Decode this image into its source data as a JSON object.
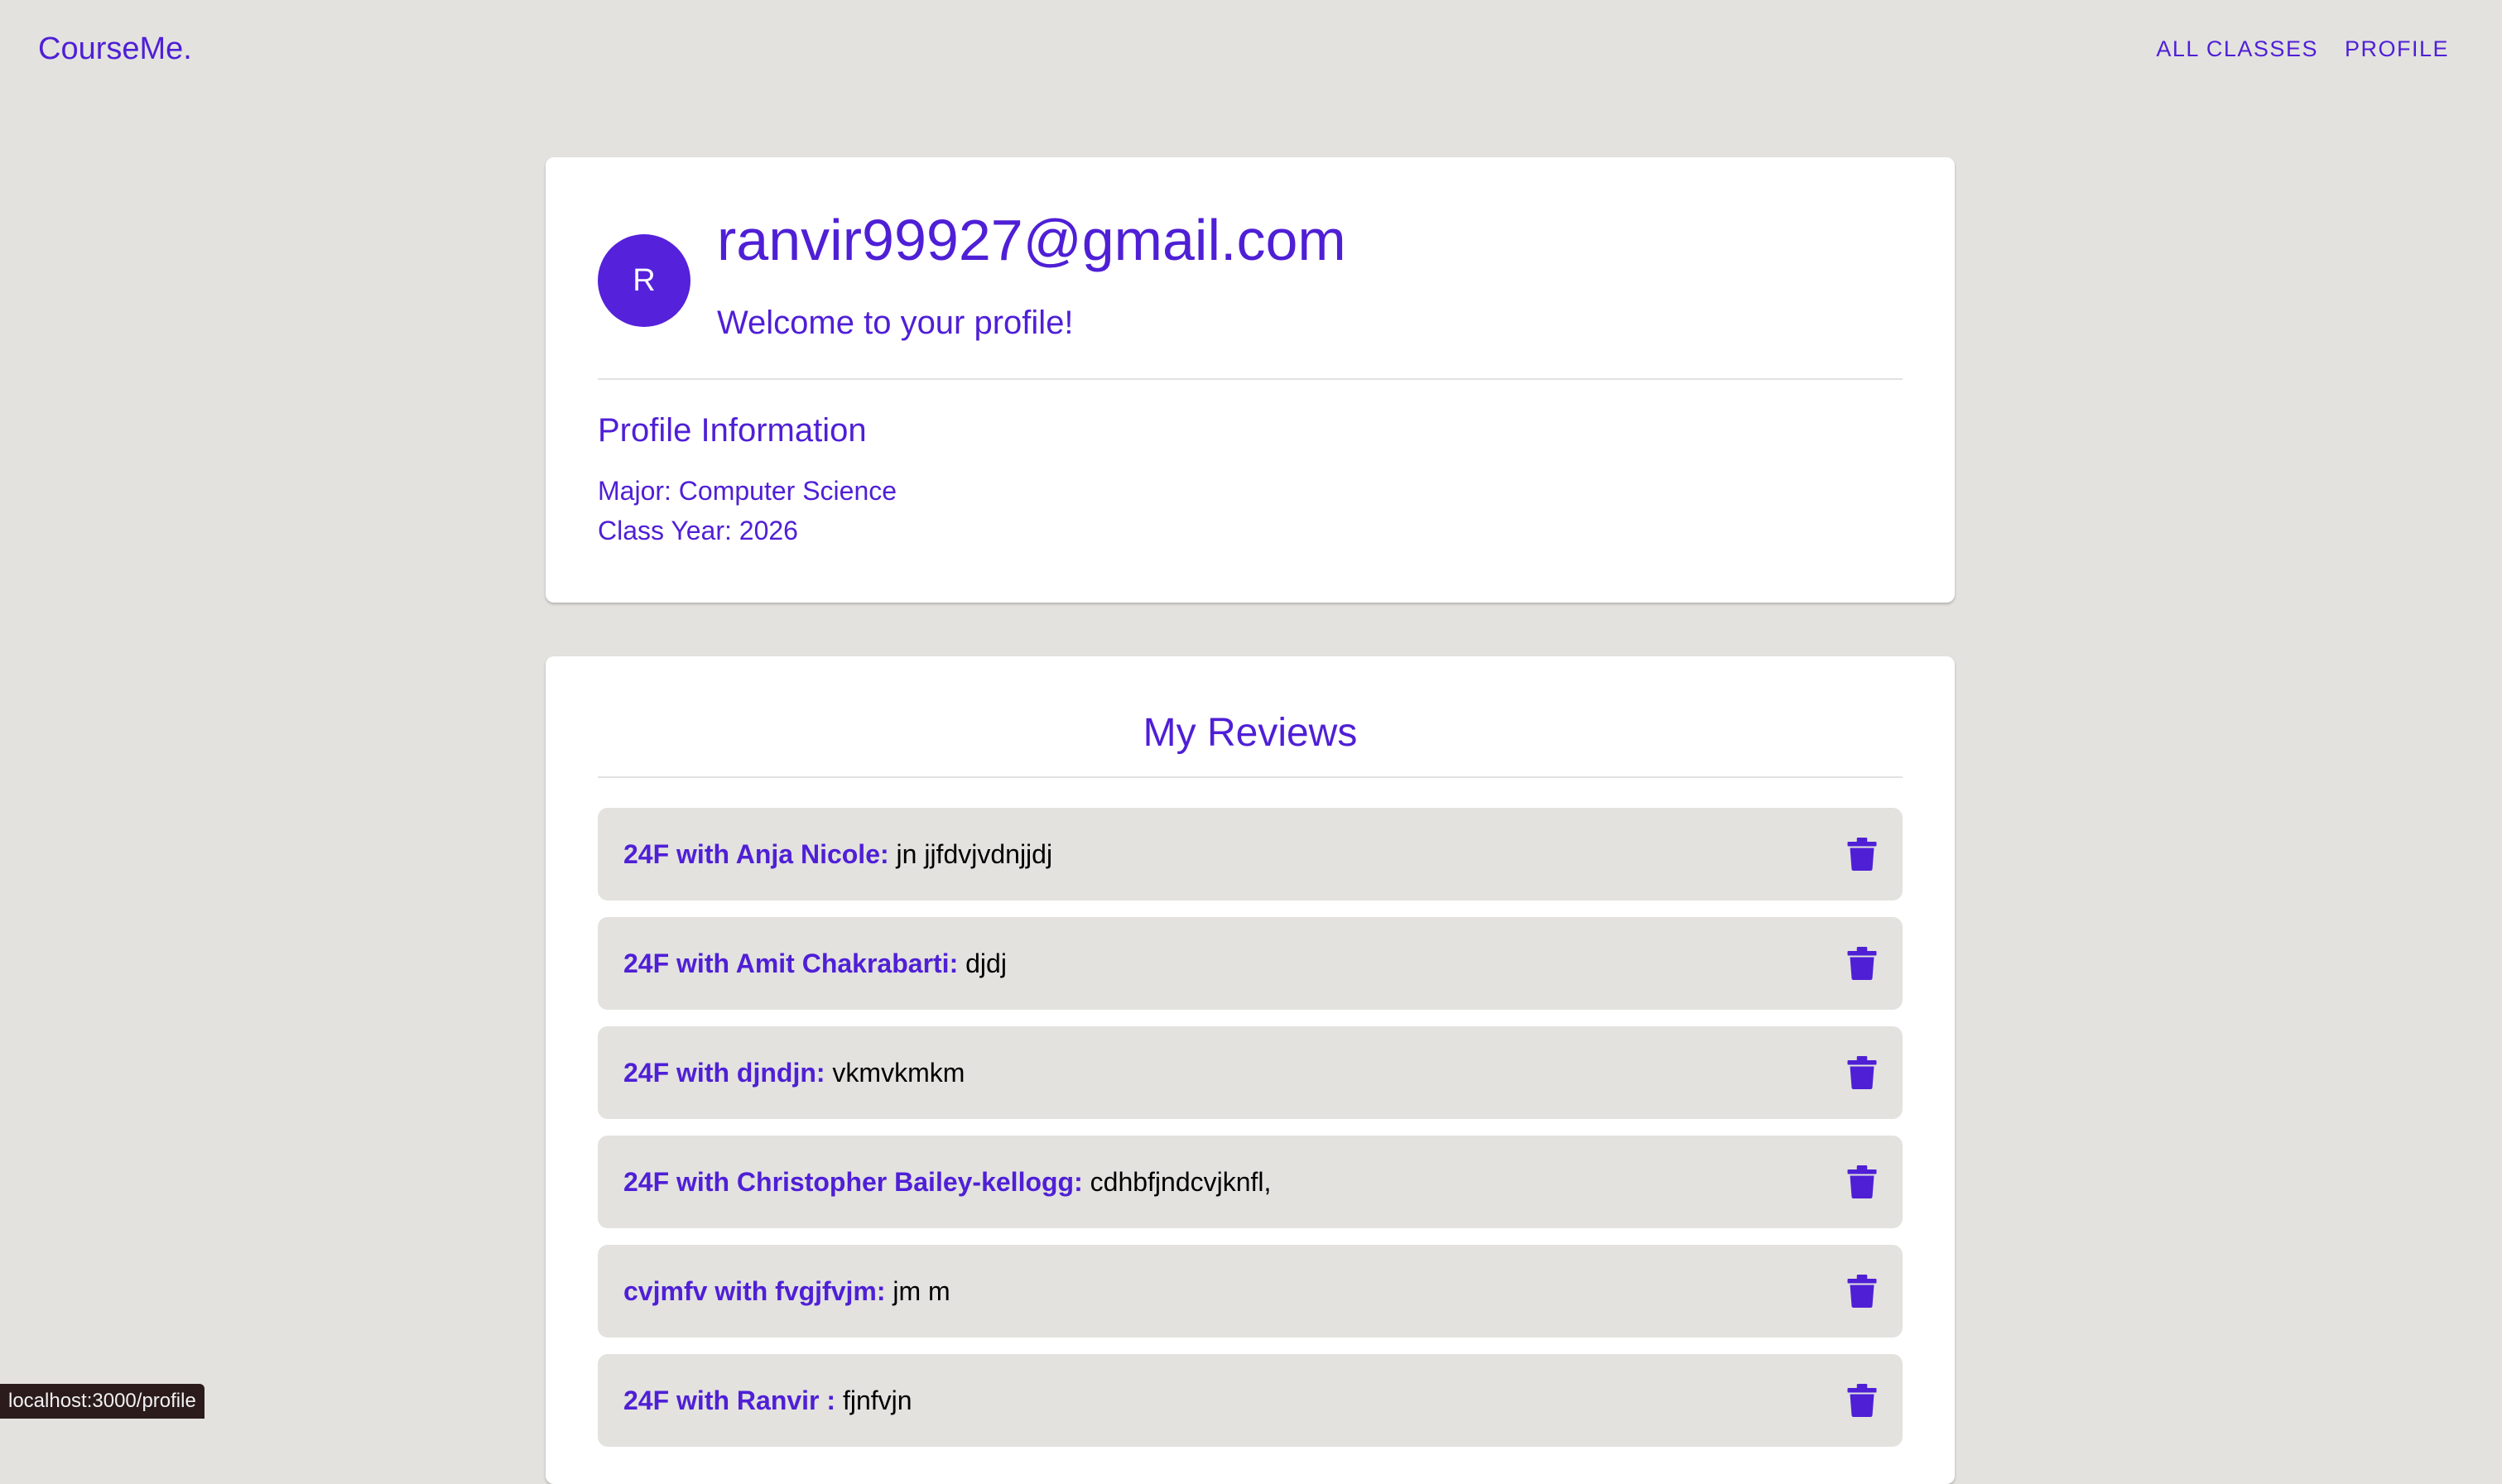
{
  "nav": {
    "brand": "CourseMe.",
    "links": [
      "ALL CLASSES",
      "PROFILE"
    ]
  },
  "profile": {
    "avatar_initial": "R",
    "email": "ranvir99927@gmail.com",
    "welcome": "Welcome to your profile!",
    "info_heading": "Profile Information",
    "major": "Major: Computer Science",
    "class_year": "Class Year: 2026"
  },
  "reviews": {
    "title": "My Reviews",
    "items": [
      {
        "label": "24F with Anja Nicole:",
        "text": " jn jjfdvjvdnjjdj"
      },
      {
        "label": "24F with Amit Chakrabarti:",
        "text": " djdj"
      },
      {
        "label": "24F with djndjn:",
        "text": " vkmvkmkm"
      },
      {
        "label": "24F with Christopher Bailey-kellogg:",
        "text": " cdhbfjndcvjknfl,"
      },
      {
        "label": "cvjmfv with fvgjfvjm:",
        "text": " jm m"
      },
      {
        "label": "24F with Ranvir :",
        "text": " fjnfvjn"
      }
    ]
  },
  "status_bar": {
    "url": "localhost:3000/profile"
  },
  "colors": {
    "accent": "#4f1fd6",
    "avatar": "#5521db",
    "background": "#e3e2df",
    "card": "#ffffff"
  },
  "icons": {
    "delete": "trash-icon"
  }
}
